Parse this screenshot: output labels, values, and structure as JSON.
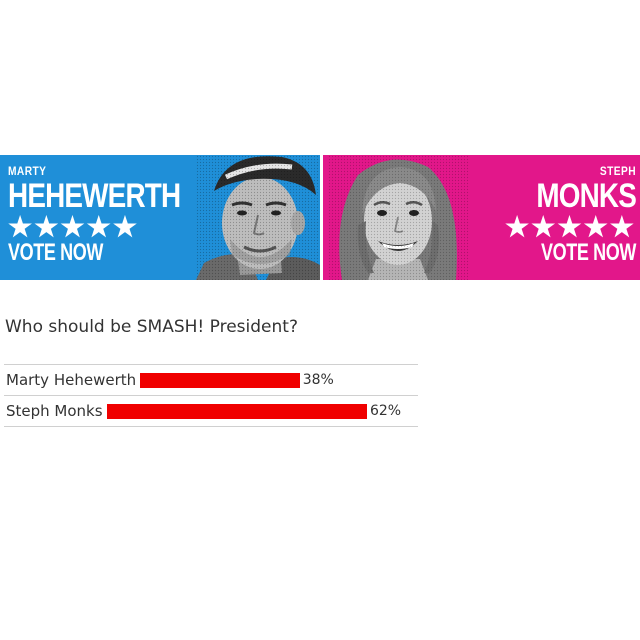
{
  "banner": {
    "left": {
      "first_name": "MARTY",
      "last_name": "HEHEWERTH",
      "stars": "★★★★★",
      "cta": "VOTE NOW",
      "bg_color": "#1f8fd8"
    },
    "right": {
      "first_name": "STEPH",
      "last_name": "MONKS",
      "stars": "★★★★★",
      "cta": "VOTE NOW",
      "bg_color": "#e2178a"
    }
  },
  "poll": {
    "question": "Who should be SMASH! President?",
    "bar_color": "#f00000",
    "options": [
      {
        "name": "Marty Hehewerth",
        "percent_label": "38%",
        "percent": 38
      },
      {
        "name": "Steph Monks",
        "percent_label": "62%",
        "percent": 62
      }
    ]
  }
}
